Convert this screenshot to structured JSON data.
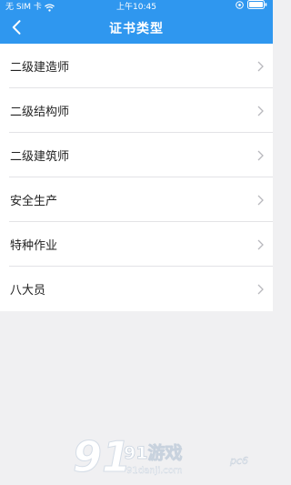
{
  "status_bar": {
    "carrier": "无 SIM 卡",
    "time": "上午10:45"
  },
  "header": {
    "title": "证书类型"
  },
  "certificate_types": [
    {
      "label": "二级建造师"
    },
    {
      "label": "二级结构师"
    },
    {
      "label": "二级建筑师"
    },
    {
      "label": "安全生产"
    },
    {
      "label": "特种作业"
    },
    {
      "label": "八大员"
    }
  ],
  "watermark": {
    "logo_text": "91游戏",
    "url": "91danji.com",
    "corner_mark": "pc6"
  },
  "colors": {
    "header_bg": "#2f97ef",
    "page_bg": "#f0f0f2",
    "row_bg": "#ffffff",
    "text": "#222222",
    "chevron": "#b8b8bd",
    "divider": "#e3e3e6"
  },
  "icons": {
    "back": "chevron-left-icon",
    "row": "chevron-right-icon",
    "status": [
      "wifi-icon",
      "lock-icon",
      "battery-icon"
    ]
  }
}
